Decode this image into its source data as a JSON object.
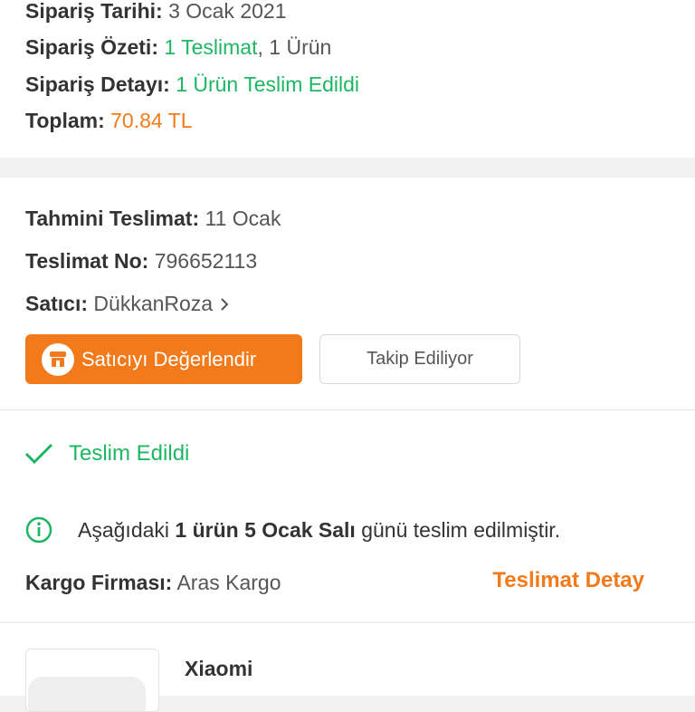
{
  "order_summary": {
    "date_label": "Sipariş Tarihi:",
    "date_value": "3 Ocak 2021",
    "summary_label": "Sipariş Özeti:",
    "summary_delivery": "1 Teslimat",
    "summary_sep": ",",
    "summary_items": "1 Ürün",
    "detail_label": "Sipariş Detayı:",
    "detail_value": "1 Ürün Teslim Edildi",
    "total_label": "Toplam:",
    "total_value": "70.84 TL"
  },
  "delivery": {
    "estimate_label": "Tahmini Teslimat:",
    "estimate_value": "11 Ocak",
    "number_label": "Teslimat No:",
    "number_value": "796652113",
    "seller_label": "Satıcı:",
    "seller_value": "DükkanRoza",
    "rate_seller_button": "Satıcıyı Değerlendir",
    "follow_button": "Takip Ediliyor"
  },
  "status": {
    "delivered_label": "Teslim Edildi",
    "info_prefix": "Aşağıdaki",
    "info_count": "1 ürün",
    "info_date": "5 Ocak Salı",
    "info_suffix": "günü teslim edilmiştir.",
    "cargo_label": "Kargo Firması:",
    "cargo_value": "Aras Kargo",
    "delivery_detail_link": "Teslimat Detay"
  },
  "product": {
    "brand": "Xiaomi"
  },
  "colors": {
    "accent_orange": "#f27a1a",
    "success_green": "#1fb663"
  },
  "icons": {
    "store": "store-icon",
    "chevron": "chevron-right-icon",
    "check": "check-icon",
    "info": "info-icon"
  }
}
